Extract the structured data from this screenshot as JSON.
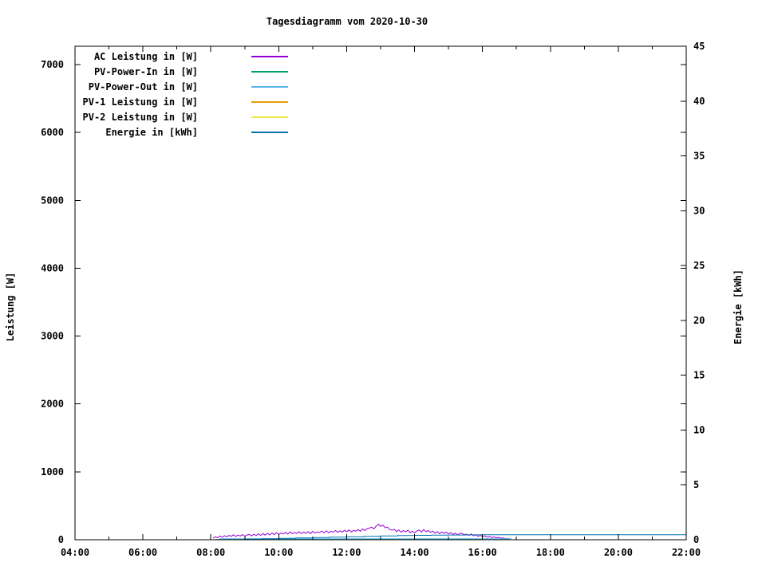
{
  "chart_data": {
    "type": "line",
    "title": "Tagesdiagramm vom 2020-10-30",
    "background_color": "#ffffff",
    "axis_color": "#000000",
    "x_axis": {
      "unit": "time",
      "range_hours": [
        4,
        22
      ],
      "major_tick_hours": [
        4,
        6,
        8,
        10,
        12,
        14,
        16,
        18,
        20,
        22
      ],
      "minor_tick_hours": [
        5,
        7,
        9,
        11,
        13,
        15,
        17,
        19,
        21
      ],
      "tick_labels": [
        "04:00",
        "06:00",
        "08:00",
        "10:00",
        "12:00",
        "14:00",
        "16:00",
        "18:00",
        "20:00",
        "22:00"
      ]
    },
    "y_left": {
      "label": "Leistung [W]",
      "range": [
        0,
        7270
      ],
      "ticks": [
        0,
        1000,
        2000,
        3000,
        4000,
        5000,
        6000,
        7000
      ],
      "tick_labels": [
        "0",
        "1000",
        "2000",
        "3000",
        "4000",
        "5000",
        "6000",
        "7000"
      ]
    },
    "y_right": {
      "label": "Energie [kWh]",
      "range": [
        0,
        45
      ],
      "ticks": [
        0,
        5,
        10,
        15,
        20,
        25,
        30,
        35,
        40,
        45
      ],
      "tick_labels": [
        "0",
        "5",
        "10",
        "15",
        "20",
        "25",
        "30",
        "35",
        "40",
        "45"
      ]
    },
    "legend": {
      "position": "top-left-inside"
    },
    "series": [
      {
        "name": "ac-leistung",
        "label": "AC Leistung in [W]",
        "color": "#9400D3",
        "axis": "left",
        "start_hour": 8.067,
        "step_hours": 0.0667,
        "values": [
          25,
          42,
          31,
          55,
          38,
          60,
          44,
          63,
          50,
          72,
          48,
          68,
          55,
          75,
          52,
          70,
          78,
          55,
          82,
          60,
          88,
          64,
          90,
          68,
          95,
          70,
          100,
          74,
          105,
          78,
          98,
          85,
          110,
          82,
          115,
          88,
          108,
          92,
          118,
          90,
          112,
          95,
          120,
          88,
          125,
          98,
          115,
          105,
          128,
          100,
          132,
          105,
          125,
          110,
          135,
          108,
          130,
          112,
          140,
          118,
          145,
          115,
          138,
          125,
          150,
          125,
          158,
          135,
          165,
          170,
          185,
          160,
          200,
          230,
          195,
          215,
          175,
          185,
          150,
          140,
          155,
          120,
          145,
          110,
          135,
          115,
          140,
          105,
          125,
          100,
          130,
          145,
          112,
          150,
          118,
          135,
          108,
          128,
          95,
          120,
          88,
          115,
          92,
          110,
          85,
          105,
          78,
          98,
          70,
          95,
          88,
          75,
          80,
          62,
          85,
          58,
          72,
          50,
          65,
          45,
          55,
          38,
          48,
          32,
          42,
          28,
          35,
          22,
          28,
          15,
          18,
          8
        ]
      },
      {
        "name": "pv-power-in",
        "label": "PV-Power-In in [W]",
        "color": "#009E73",
        "axis": "left",
        "points": [
          [
            8.12,
            4
          ],
          [
            9.0,
            8
          ],
          [
            10.0,
            10
          ],
          [
            11.0,
            11
          ],
          [
            12.0,
            12
          ],
          [
            13.0,
            12
          ],
          [
            14.0,
            10
          ],
          [
            15.0,
            8
          ],
          [
            16.0,
            5
          ],
          [
            16.8,
            2
          ]
        ]
      },
      {
        "name": "pv-power-out",
        "label": "PV-Power-Out in [W]",
        "color": "#56B4E9",
        "axis": "left",
        "points": [
          [
            8.25,
            15
          ],
          [
            16.85,
            15
          ]
        ]
      },
      {
        "name": "pv-1-leistung",
        "label": "PV-1 Leistung in [W]",
        "color": "#E69F00",
        "axis": "left",
        "points": [
          [
            8.1,
            0
          ],
          [
            16.85,
            0
          ]
        ]
      },
      {
        "name": "pv-2-leistung",
        "label": "PV-2 Leistung in [W]",
        "color": "#F0E442",
        "axis": "left",
        "points": [
          [
            8.1,
            0
          ],
          [
            16.85,
            0
          ]
        ]
      },
      {
        "name": "energie",
        "label": "Energie in [kWh]",
        "color": "#0072B2",
        "axis": "right",
        "step": true,
        "points": [
          [
            8.4,
            0.0
          ],
          [
            9.0,
            0.05
          ],
          [
            9.5,
            0.09
          ],
          [
            10.0,
            0.13
          ],
          [
            10.5,
            0.17
          ],
          [
            11.0,
            0.2
          ],
          [
            11.5,
            0.24
          ],
          [
            12.0,
            0.27
          ],
          [
            12.5,
            0.31
          ],
          [
            13.0,
            0.35
          ],
          [
            13.5,
            0.38
          ],
          [
            14.0,
            0.4
          ],
          [
            14.5,
            0.42
          ],
          [
            15.0,
            0.43
          ],
          [
            15.5,
            0.44
          ],
          [
            16.0,
            0.45
          ],
          [
            22.0,
            0.45
          ]
        ]
      }
    ]
  }
}
